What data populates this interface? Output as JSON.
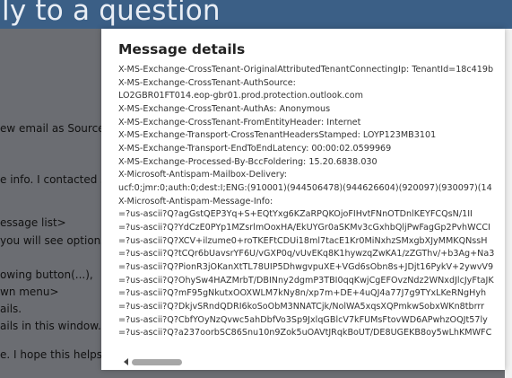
{
  "background": {
    "title": "ly to a question",
    "lines": [
      "ew email as Source (H",
      "e info. I contacted su",
      "essage list>",
      "you will see options",
      "owing button(...),",
      "wn menu>",
      "ails.",
      "ails in this window.",
      "e. I hope this helps s"
    ]
  },
  "modal": {
    "title": "Message details",
    "header_lines": [
      "X-MS-Exchange-CrossTenant-OriginalAttributedTenantConnectingIp: TenantId=18c419b",
      "X-MS-Exchange-CrossTenant-AuthSource:",
      " LO2GBR01FT014.eop-gbr01.prod.protection.outlook.com",
      "X-MS-Exchange-CrossTenant-AuthAs: Anonymous",
      "X-MS-Exchange-CrossTenant-FromEntityHeader: Internet",
      "X-MS-Exchange-Transport-CrossTenantHeadersStamped: LOYP123MB3101",
      "X-MS-Exchange-Transport-EndToEndLatency: 00:00:02.0599969",
      "X-MS-Exchange-Processed-By-BccFoldering: 15.20.6838.030",
      "X-Microsoft-Antispam-Mailbox-Delivery:",
      "        ucf:0;jmr:0;auth:0;dest:I;ENG:(910001)(944506478)(944626604)(920097)(930097)(14",
      "X-Microsoft-Antispam-Message-Info:",
      "        =?us-ascii?Q?agGstQEP3Yq+S+EQtYxg6KZaRPQKOjoFIHvtFNnOTDnlKEYFCQsN/1II",
      " =?us-ascii?Q?YdCzE0PYp1MZsrlmOoxHA/EkUYGr0aSKMv3cGxhbQljPwFagGp2PvhWCCI",
      " =?us-ascii?Q?XCV+ilzume0+roTKEFtCDUi18ml7tacE1Kr0MiNxhzSMxgbXJyMMKQNssH",
      " =?us-ascii?Q?tCQr6bUavsrYF6U/vGXP0q/vUvEKq8K1hywzqZwKA1/zZGThv/+b3Ag+Na3",
      " =?us-ascii?Q?PionR3jOKanXtTL78UIP5DhwgvpuXE+VGd6sObn8s+JDjt16PykV+2ywvV9",
      " =?us-ascii?Q?OhySw4HAZMrbT/DBINny2dgmP3TBI0qqKwjCgEFOvzNdz2WNxdJlcJyFtaJK",
      " =?us-ascii?Q?mF95gNkutxOOXWLM7kNy8n/xp7m+DE+4uQJ4a77J7g9TYxLKeRNgHyh",
      " =?us-ascii?Q?DkjvSRndQDRI6koSoObM3NNATCjk/NolWA5xqsXQPmkwSobxWKn8tbrrr",
      " =?us-ascii?Q?CbfYOyNzQvwc5ahDbfVo3Sp9JxlqGBlcV7kFUMsFtovWD6APwhzOQJt57ly",
      " =?us-ascii?Q?a237oorbSC86Snu10n9Zok5uOAVtJRqkBoUT/DE8UGEKB8oy5wLhKMWFC"
    ]
  }
}
